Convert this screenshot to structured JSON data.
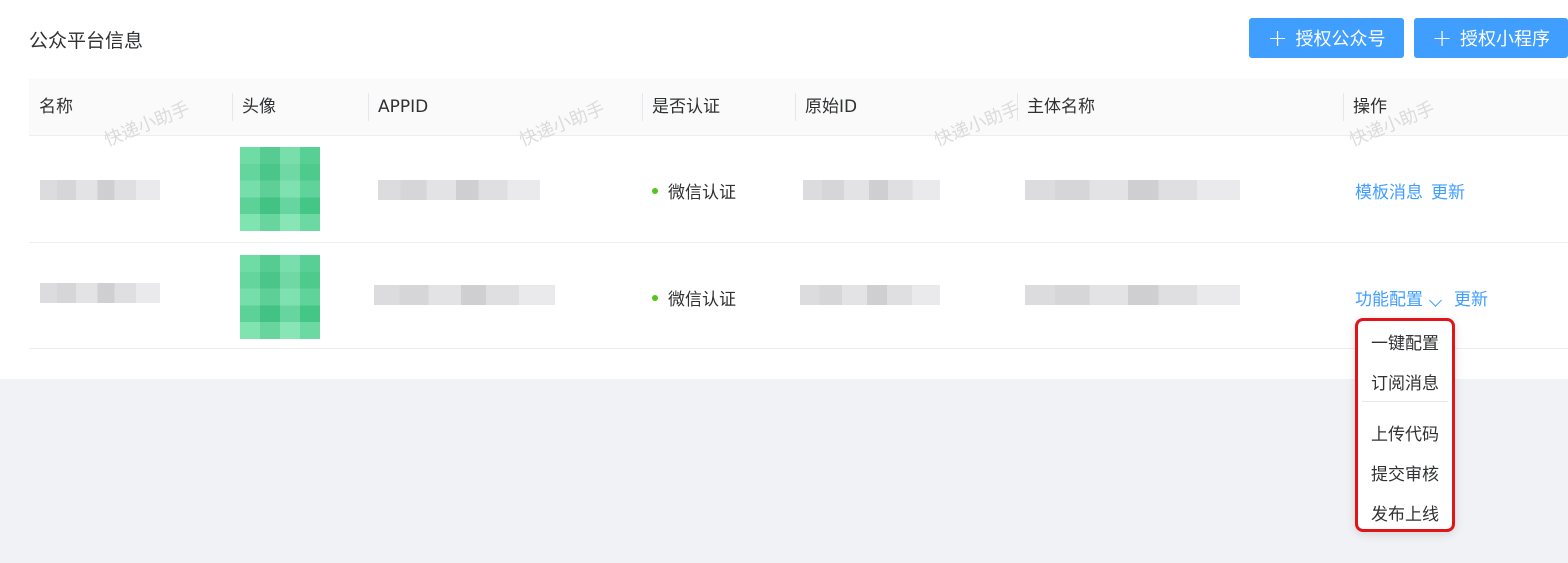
{
  "header": {
    "title": "公众平台信息"
  },
  "actions": {
    "authorize_oa": "授权公众号",
    "authorize_mp": "授权小程序",
    "plus": "+"
  },
  "table": {
    "columns": [
      "名称",
      "头像",
      "APPID",
      "是否认证",
      "原始ID",
      "主体名称",
      "操作"
    ],
    "rows": [
      {
        "cert": "微信认证",
        "ops": [
          "模板消息",
          "更新"
        ]
      },
      {
        "cert": "微信认证",
        "ops": [
          "功能配置",
          "更新"
        ]
      }
    ]
  },
  "dropdown": {
    "items": [
      "一键配置",
      "订阅消息",
      "上传代码",
      "提交审核",
      "发布上线"
    ]
  },
  "watermark": "快递小助手",
  "colors": {
    "primary": "#409eff",
    "success": "#52c41a",
    "highlight": "#e0151a",
    "background": "#f0f2f5"
  }
}
